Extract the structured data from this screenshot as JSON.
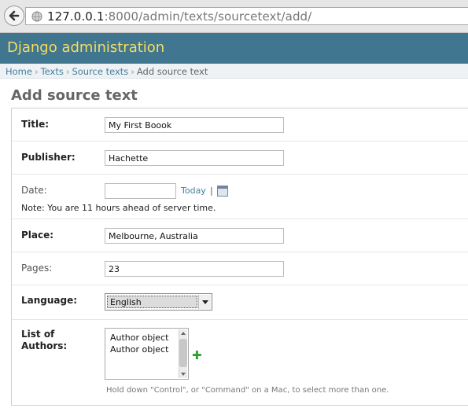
{
  "browser": {
    "url_host": "127.0.0.1",
    "url_path": ":8000/admin/texts/sourcetext/add/"
  },
  "header": {
    "title": "Django administration"
  },
  "breadcrumbs": {
    "home": "Home",
    "texts": "Texts",
    "sourcetexts": "Source texts",
    "current": "Add source text",
    "separator": "›"
  },
  "page": {
    "title": "Add source text"
  },
  "form": {
    "title": {
      "label": "Title:",
      "value": "My First Boook"
    },
    "publisher": {
      "label": "Publisher:",
      "value": "Hachette"
    },
    "date": {
      "label": "Date:",
      "value": "",
      "today_link": "Today",
      "pipe": "|",
      "note": "Note: You are 11 hours ahead of server time."
    },
    "place": {
      "label": "Place:",
      "value": "Melbourne, Australia"
    },
    "pages": {
      "label": "Pages:",
      "value": "23"
    },
    "language": {
      "label": "Language:",
      "selected": "English"
    },
    "authors": {
      "label_line1": "List of",
      "label_line2": "Authors:",
      "options": [
        "Author object",
        "Author object"
      ],
      "add_symbol": "✚",
      "help": "Hold down \"Control\", or \"Command\" on a Mac, to select more than one."
    }
  },
  "colors": {
    "header_bg": "#417690",
    "header_text": "#f5dd5d",
    "link": "#447e9b",
    "add_icon": "#2da12d"
  }
}
